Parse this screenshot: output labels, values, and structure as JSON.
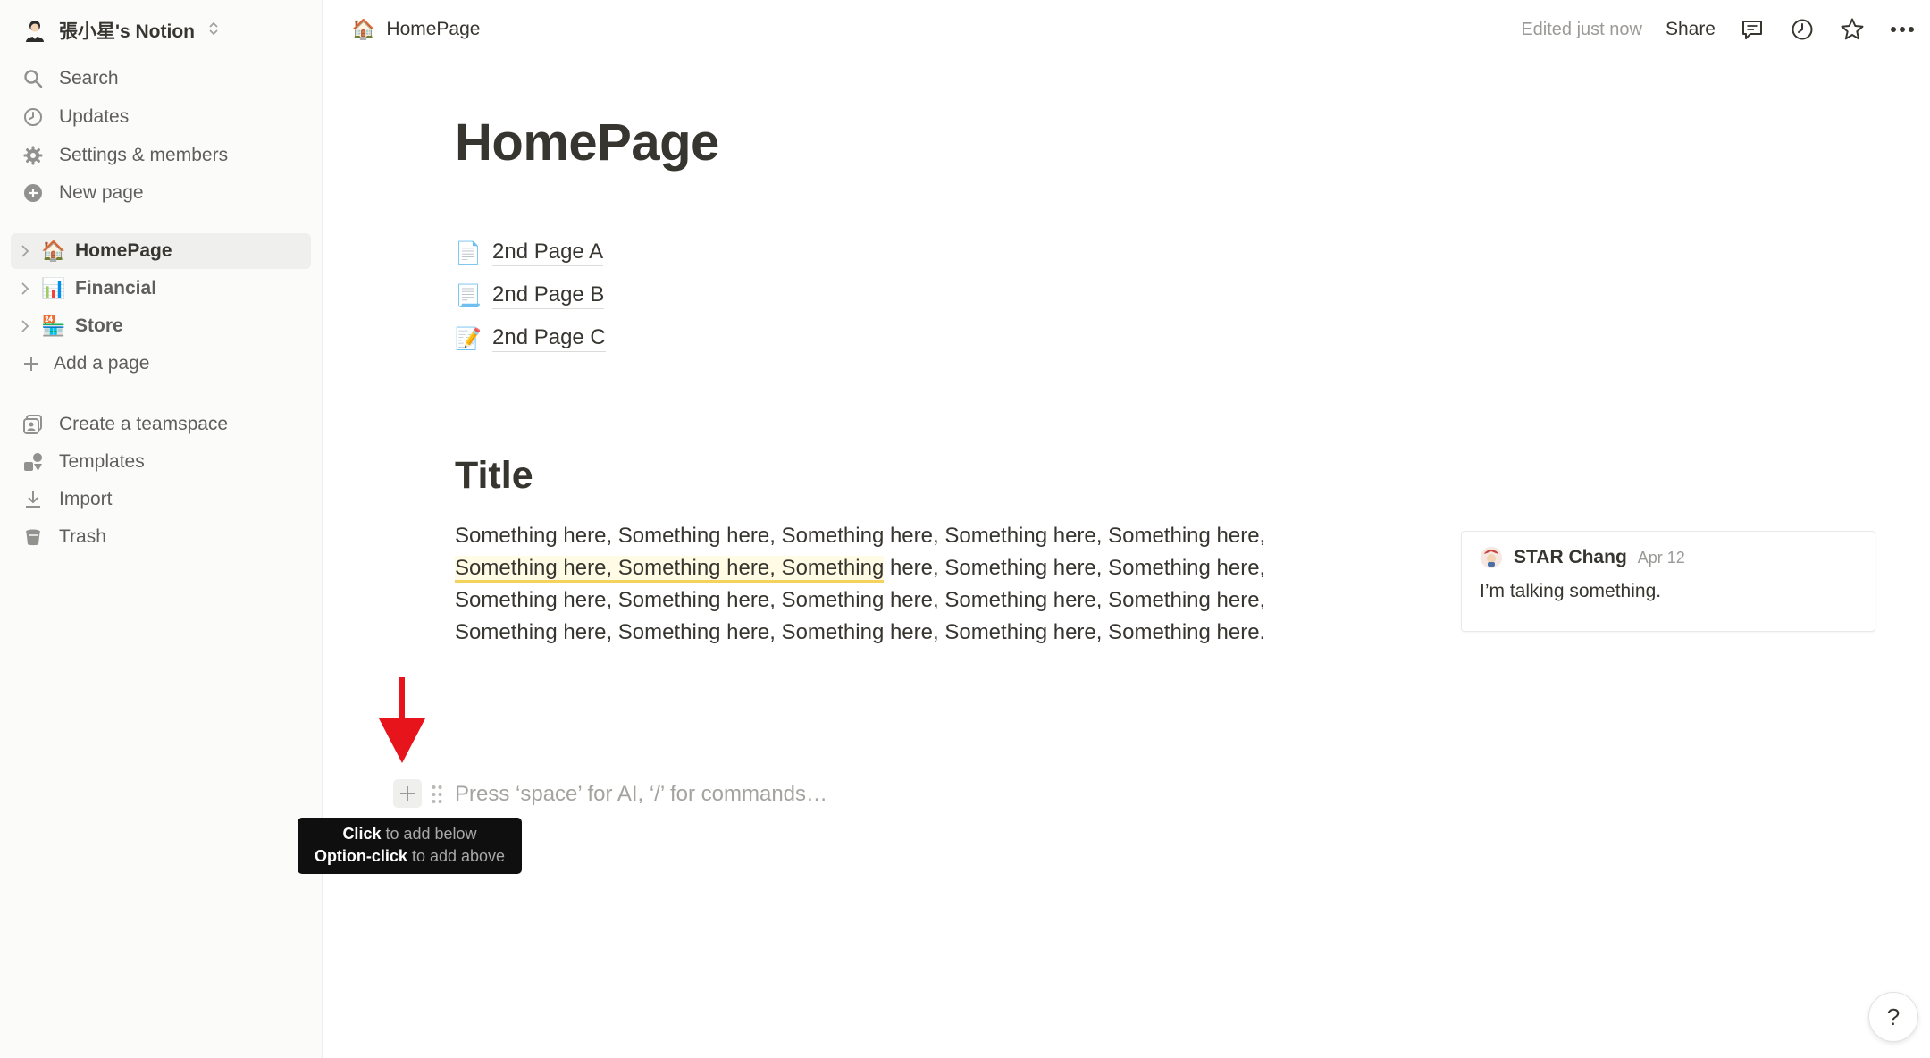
{
  "workspace": {
    "name": "張小星's Notion",
    "avatar_icon": "person-avatar-icon"
  },
  "sidebar": {
    "nav": [
      {
        "label": "Search",
        "icon": "search-icon"
      },
      {
        "label": "Updates",
        "icon": "clock-icon"
      },
      {
        "label": "Settings & members",
        "icon": "gear-icon"
      },
      {
        "label": "New page",
        "icon": "plus-circle-icon"
      }
    ],
    "pages": [
      {
        "label": "HomePage",
        "emoji": "🏠",
        "active": true
      },
      {
        "label": "Financial",
        "emoji": "📊",
        "active": false
      },
      {
        "label": "Store",
        "emoji": "🏪",
        "active": false
      }
    ],
    "add_page": "Add a page",
    "footer": [
      {
        "label": "Create a teamspace",
        "icon": "teamspace-icon"
      },
      {
        "label": "Templates",
        "icon": "templates-icon"
      },
      {
        "label": "Import",
        "icon": "download-icon"
      },
      {
        "label": "Trash",
        "icon": "trash-icon"
      }
    ]
  },
  "topbar": {
    "breadcrumb": "HomePage",
    "breadcrumb_emoji": "🏠",
    "edited": "Edited just now",
    "share": "Share"
  },
  "page": {
    "title": "HomePage",
    "subpages": [
      {
        "label": "2nd Page A",
        "emoji": "📄"
      },
      {
        "label": "2nd Page B",
        "emoji": "📃"
      },
      {
        "label": "2nd Page C",
        "emoji": "📝"
      }
    ],
    "heading": "Title",
    "paragraph_highlighted": "Something here, Something here, Something",
    "paragraph_before": "Something here, Something here, Something here, Something here, Something here, ",
    "paragraph_after": " here, Something here, Something here, Something here, Something here, Something here, Something here, Something here, Something here, Something here, Something here, Something here, Something here.",
    "placeholder": "Press ‘space’ for AI, ‘/’ for commands…"
  },
  "comment": {
    "author": "STAR Chang",
    "date": "Apr 12",
    "text": "I’m talking something."
  },
  "tooltip": {
    "line1_bold": "Click",
    "line1_rest": " to add below",
    "line2_bold": "Option-click",
    "line2_rest": " to add above"
  },
  "help": "?",
  "colors": {
    "annotation_arrow": "#e8141b",
    "highlight_underline": "#f5d25c",
    "sidebar_bg": "#fbfbfa"
  }
}
